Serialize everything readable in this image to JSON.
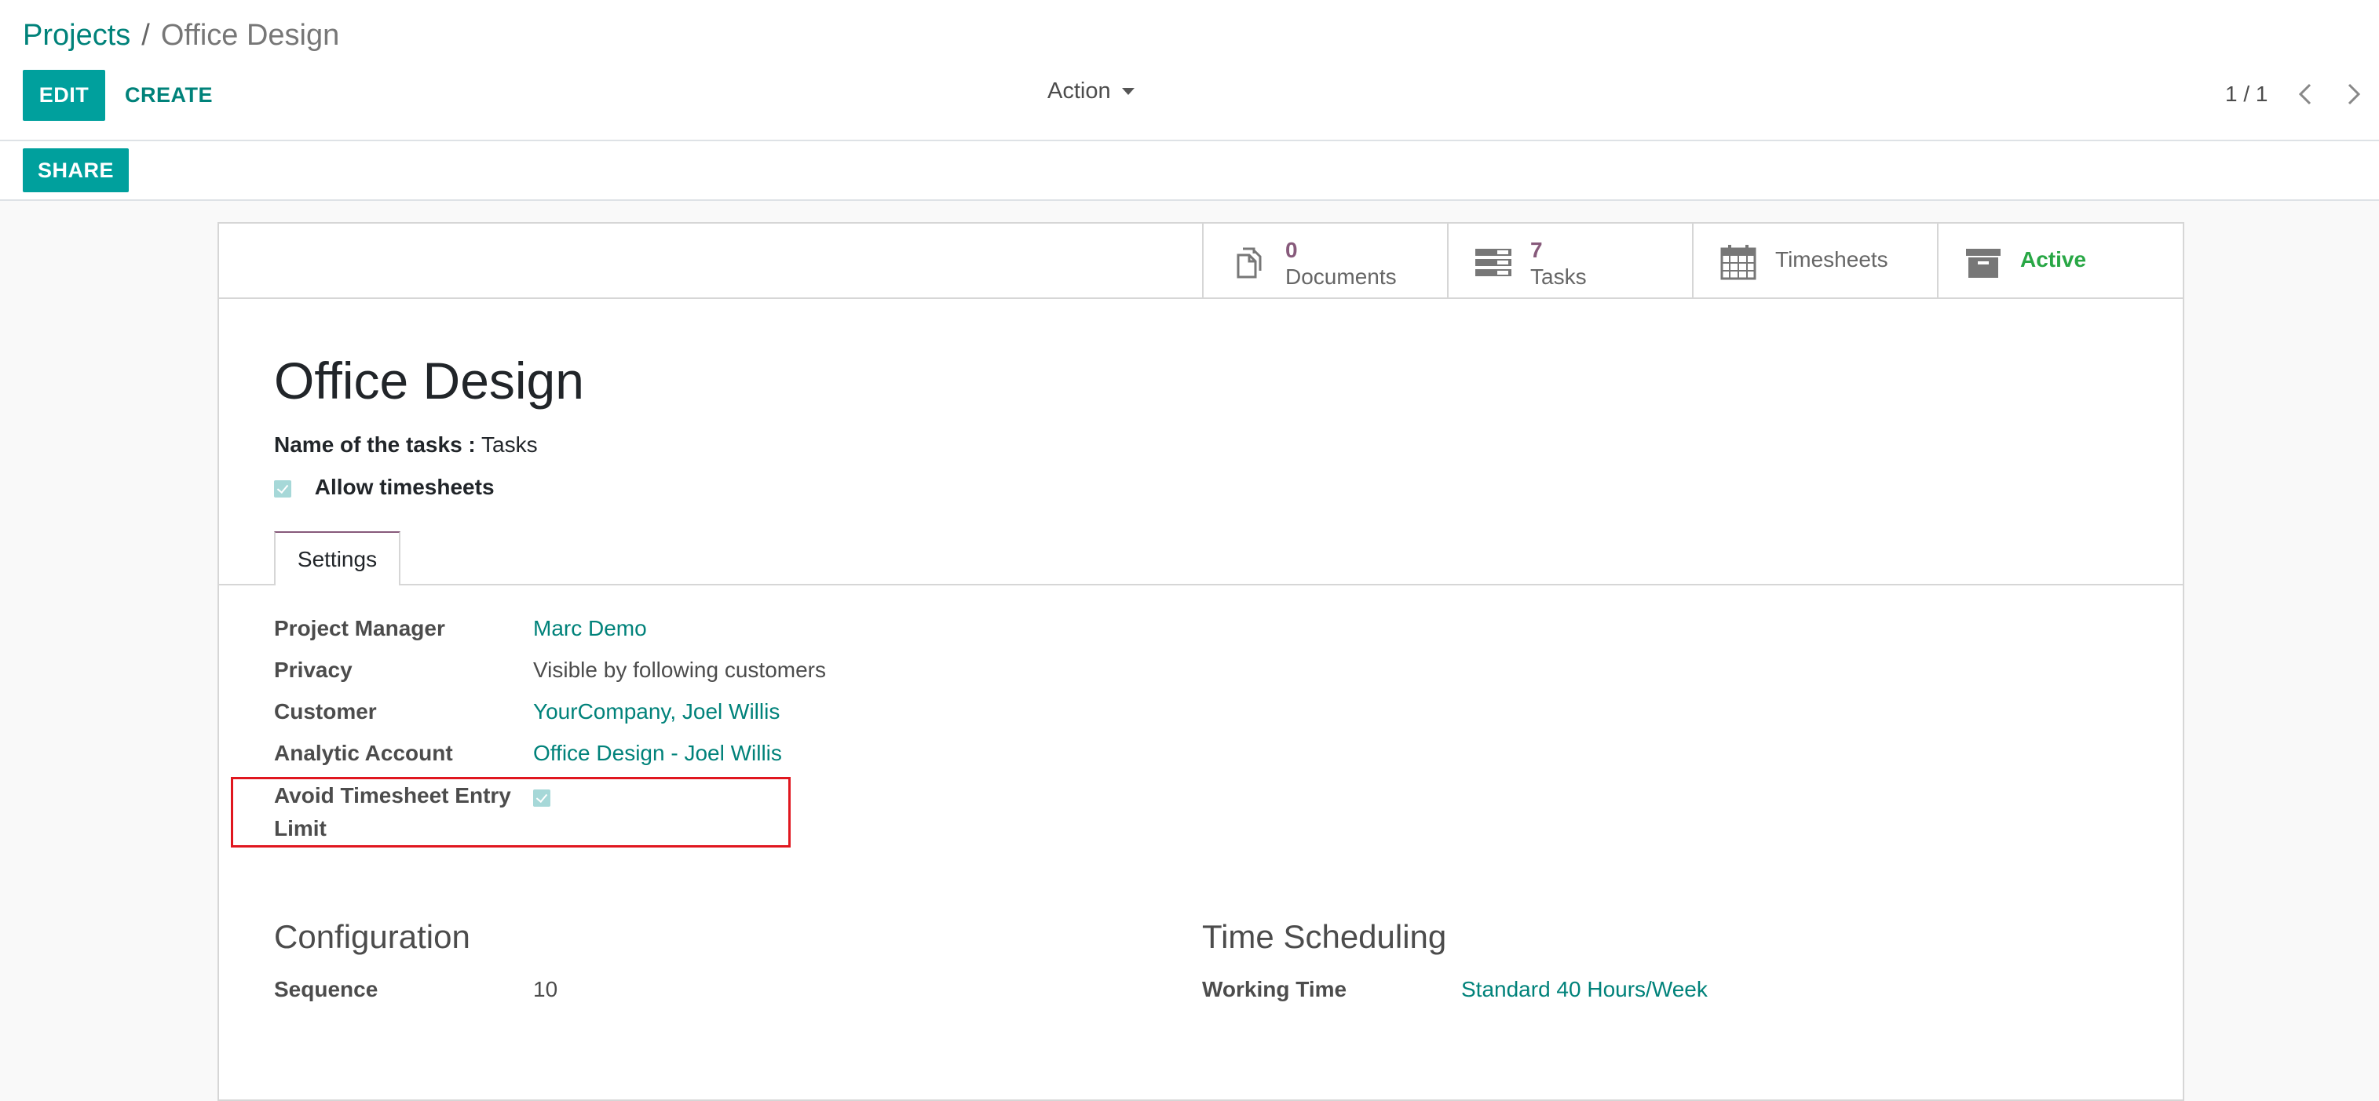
{
  "breadcrumb": {
    "parent": "Projects",
    "separator": "/",
    "current": "Office Design"
  },
  "toolbar": {
    "edit_label": "EDIT",
    "create_label": "CREATE",
    "action_label": "Action",
    "share_label": "SHARE"
  },
  "pager": {
    "value": "1 / 1"
  },
  "smart_buttons": {
    "documents": {
      "value": "0",
      "label": "Documents"
    },
    "tasks": {
      "value": "7",
      "label": "Tasks"
    },
    "timesheets": {
      "label": "Timesheets"
    },
    "active": {
      "label": "Active"
    }
  },
  "record": {
    "title": "Office Design",
    "tasks_name_label": "Name of the tasks :",
    "tasks_name_value": "Tasks",
    "allow_timesheets_label": "Allow timesheets",
    "allow_timesheets_checked": true
  },
  "tabs": [
    {
      "label": "Settings"
    }
  ],
  "settings": {
    "project_manager": {
      "label": "Project Manager",
      "value": "Marc Demo"
    },
    "privacy": {
      "label": "Privacy",
      "value": "Visible by following customers"
    },
    "customer": {
      "label": "Customer",
      "value": "YourCompany, Joel Willis"
    },
    "analytic_account": {
      "label": "Analytic Account",
      "value": "Office Design - Joel Willis"
    },
    "avoid_limit": {
      "label_line1": "Avoid Timesheet Entry",
      "label_line2": "Limit",
      "checked": true
    }
  },
  "configuration": {
    "title": "Configuration",
    "sequence_label": "Sequence",
    "sequence_value": "10"
  },
  "time_scheduling": {
    "title": "Time Scheduling",
    "working_time_label": "Working Time",
    "working_time_value": "Standard 40 Hours/Week"
  },
  "colors": {
    "primary": "#00a09d",
    "link": "#00827a",
    "accent": "#875a7b",
    "active": "#28a745",
    "highlight": "#e0171f"
  }
}
